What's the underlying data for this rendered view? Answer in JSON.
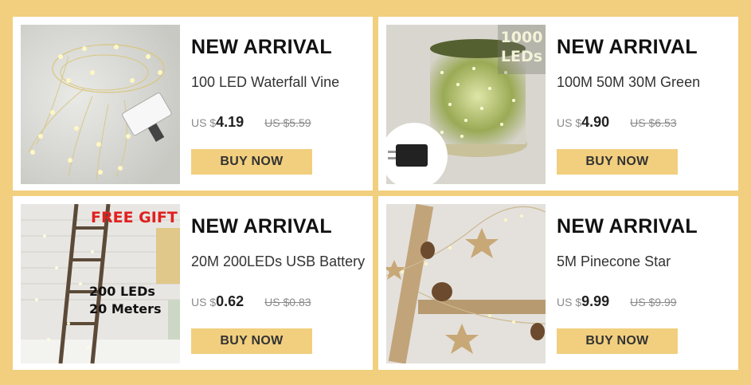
{
  "products": [
    {
      "badge": "NEW ARRIVAL",
      "name": "100 LED Waterfall Vine",
      "currency": "US $",
      "price": "4.19",
      "old_price": "US $5.59",
      "button": "BUY NOW",
      "image_icon": "fairy-light-vine-image"
    },
    {
      "badge": "NEW ARRIVAL",
      "name": "100M 50M 30M Green",
      "currency": "US $",
      "price": "4.90",
      "old_price": "US $6.53",
      "button": "BUY NOW",
      "image_icon": "green-light-spool-image",
      "image_text": "1000 LEDs"
    },
    {
      "badge": "NEW ARRIVAL",
      "name": "20M 200LEDs USB Battery",
      "currency": "US $",
      "price": "0.62",
      "old_price": "US $0.83",
      "button": "BUY NOW",
      "image_icon": "ladder-lights-image",
      "image_text_top": "FREE GIFT",
      "image_text_line1": "200 LEDs",
      "image_text_line2": "20 Meters"
    },
    {
      "badge": "NEW ARRIVAL",
      "name": "5M Pinecone Star",
      "currency": "US $",
      "price": "9.99",
      "old_price": "US $9.99",
      "button": "BUY NOW",
      "image_icon": "pinecone-star-garland-image"
    }
  ],
  "colors": {
    "background": "#f1cf7e",
    "button": "#f1cf7e",
    "card": "#ffffff",
    "gift_text": "#e02020"
  }
}
